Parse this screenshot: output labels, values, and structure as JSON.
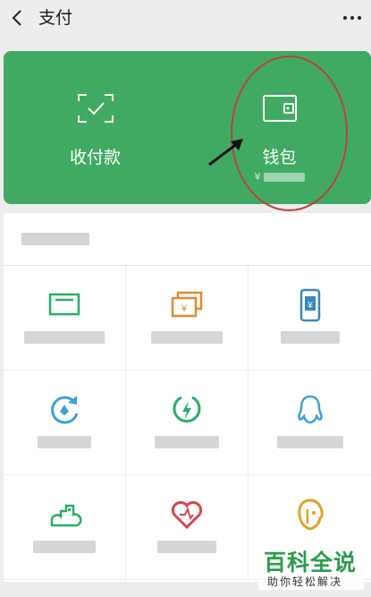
{
  "header": {
    "title": "支付"
  },
  "card": {
    "left_label": "收付款",
    "right_label": "钱包",
    "balance_prefix": "¥"
  },
  "grid": {
    "icons": [
      "card-icon",
      "money-icon",
      "phone-yuan-icon",
      "refresh-icon",
      "lightning-icon",
      "penguin-icon",
      "city-icon",
      "heart-icon",
      "face-icon"
    ]
  },
  "watermark": {
    "title": "百科全说",
    "subtitle": "助你轻松解决"
  }
}
